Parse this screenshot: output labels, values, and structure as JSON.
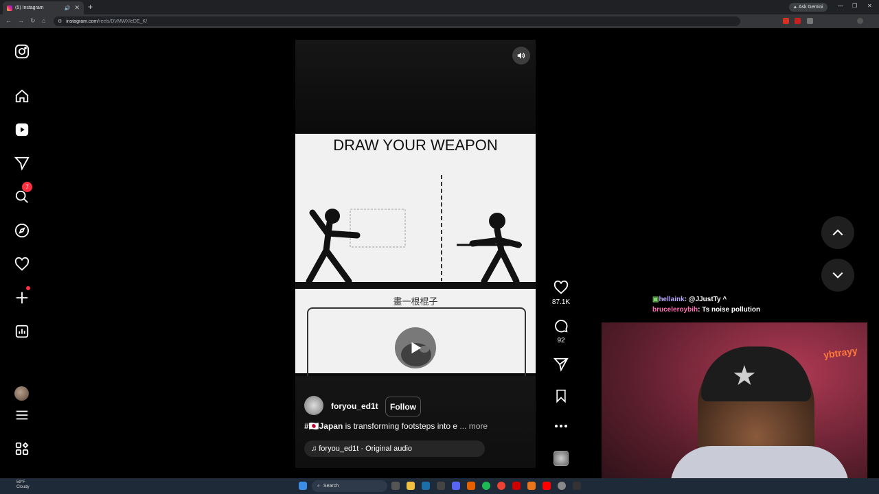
{
  "browser": {
    "tab_title": "(5) Instagram",
    "url_host": "instagram.com",
    "url_path": "/reels/DVMWXIeDE_K/",
    "ask_gemini": "Ask Gemini"
  },
  "reel": {
    "video_title": "DRAW YOUR WEAPON",
    "video_subtitle": "畫一根棍子",
    "username": "foryou_ed1t",
    "follow_label": "Follow",
    "caption_tag": "#🇯🇵Japan",
    "caption_text": " is transforming footsteps into e ",
    "caption_more": "... more",
    "audio_label": "foryou_ed1t · Original audio",
    "likes": "87.1K",
    "comments": "92"
  },
  "sidebar": {
    "messages_badge": "7"
  },
  "chat": [
    {
      "user": "hellaink",
      "message": ": @JJustTy ^",
      "color": "#b7a6ff"
    },
    {
      "user": "bruceleroybih",
      "message": ": Ts noise pollution",
      "color": "#ff6fb5"
    }
  ],
  "webcam": {
    "neon_text": "ybtrayy"
  },
  "taskbar": {
    "weather_temp": "59°F",
    "weather_desc": "Cloudy",
    "search_placeholder": "Search"
  },
  "colors": {
    "instagram_bg": "#000000",
    "badge_red": "#ff3040",
    "chrome_dark": "#202124"
  },
  "icons": [
    "instagram-icon",
    "home-icon",
    "reels-icon",
    "messages-icon",
    "search-icon",
    "explore-icon",
    "notifications-icon",
    "create-icon",
    "dashboard-icon",
    "menu-icon",
    "more-apps-icon",
    "heart-icon",
    "comment-icon",
    "share-icon",
    "bookmark-icon",
    "more-icon",
    "volume-icon",
    "play-icon",
    "chevron-up-icon",
    "chevron-down-icon"
  ]
}
